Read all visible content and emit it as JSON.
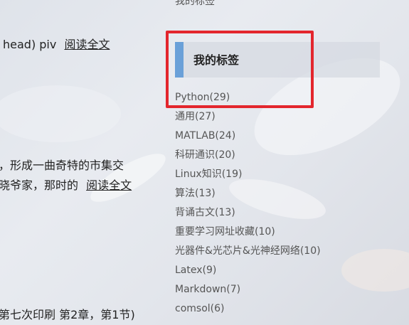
{
  "articles": [
    {
      "text": "head) piv",
      "more": "阅读全文"
    },
    {
      "text": "，形成一曲奇特的市集交"
    },
    {
      "text": "晓爷家，那时的",
      "more": "阅读全文"
    },
    {
      "text": "第七次印刷 第2章，第1节)"
    }
  ],
  "sidebar": {
    "top_cut_label": "我的标签",
    "tags_title": "我的标签",
    "tags": [
      "Python(29)",
      "通用(27)",
      "MATLAB(24)",
      "科研通识(20)",
      "Linux知识(19)",
      "算法(13)",
      "背诵古文(13)",
      "重要学习网址收藏(10)",
      "光器件&光芯片&光神经网络(10)",
      "Latex(9)",
      "Markdown(7)",
      "comsol(6)"
    ]
  },
  "colors": {
    "accent_bar": "#6aa0d8",
    "highlight_box": "#e3262d"
  }
}
